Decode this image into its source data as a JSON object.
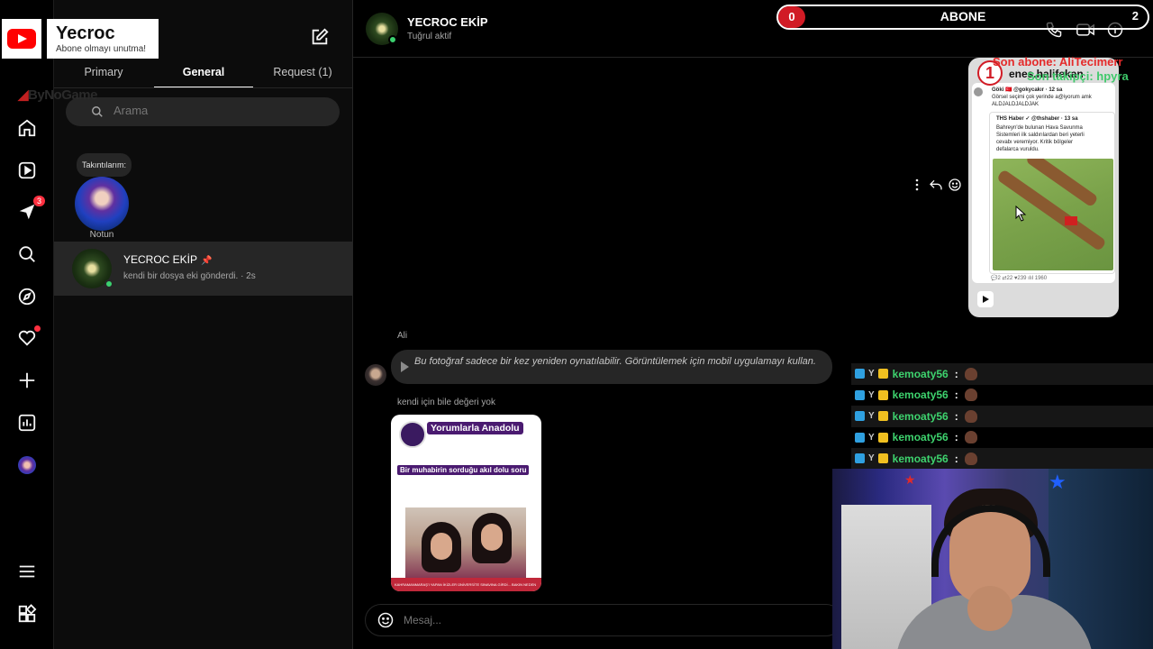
{
  "overlay": {
    "channel_name": "Yecroc",
    "channel_tagline": "Abone olmayı unutma!",
    "watermark_brand": "ByNoGame",
    "abone_count": "0",
    "abone_label": "ABONE",
    "abone_goal": "2",
    "son_abone": "Son abone: AliTecimerr",
    "son_takipci": "Son takipçi: hpyra",
    "post_badge": "1"
  },
  "rail": {
    "notifications_badge": "3"
  },
  "inbox": {
    "tabs": [
      {
        "label": "Primary"
      },
      {
        "label": "General"
      },
      {
        "label": "Request (1)"
      }
    ],
    "search_placeholder": "Arama",
    "note_bubble": "Takıntılarım:",
    "note_label": "Notun",
    "conversation": {
      "name": "YECROC EKİP",
      "pin": "📌",
      "preview": "kendi bir dosya eki gönderdi. · 2s"
    }
  },
  "chat": {
    "header": {
      "name": "YECROC EKİP",
      "status": "Tuğrul aktif"
    },
    "shared_post": {
      "user": "enes.halifekan",
      "tweet_author": "Göki 🇹🇷 @gokycakır · 12 sa",
      "tweet_text": "Görsel seçimi çok yerinde a@iyorum amk ALDJALDJALDJAK",
      "quoted_author": "THS Haber ✓ @thshaber · 13 sa",
      "quoted_text": "Bahreyn'de bulunan Hava Savunma Sistemleri ilk saldırılardan beri yeterli cevabı veremiyor. Kritik bölgeler defalarca vuruldu.",
      "stats": "💬2   ⇄22   ♥239   ılıl 1960"
    },
    "messages": [
      {
        "sender": "Ali",
        "text": "Bu fotoğraf sadece bir kez yeniden oynatılabilir. Görüntülemek için mobil uygulamayı kullan."
      },
      {
        "reply_label": "kendi için bile değeri yok",
        "meme_title": "Yorumlarla Anadolu",
        "meme_caption": "Bir muhabirin sorduğu akıl dolu soru",
        "meme_band": "KAHRAMANMARAŞ'I YAPAN İKİZLER ÜNİVERSİTE SINAVINA GİRDİ... BAKIN NEDEN"
      }
    ],
    "composer_placeholder": "Mesaj..."
  },
  "stream_chat": [
    {
      "user": "kemoaty56",
      "sep": ":"
    },
    {
      "user": "kemoaty56",
      "sep": ":"
    },
    {
      "user": "kemoaty56",
      "sep": ":"
    },
    {
      "user": "kemoaty56",
      "sep": ":"
    },
    {
      "user": "kemoaty56",
      "sep": ":"
    }
  ],
  "colors": {
    "accent_red": "#d11b25",
    "online_green": "#3bd16f",
    "chat_name_green": "#3ed36e"
  }
}
